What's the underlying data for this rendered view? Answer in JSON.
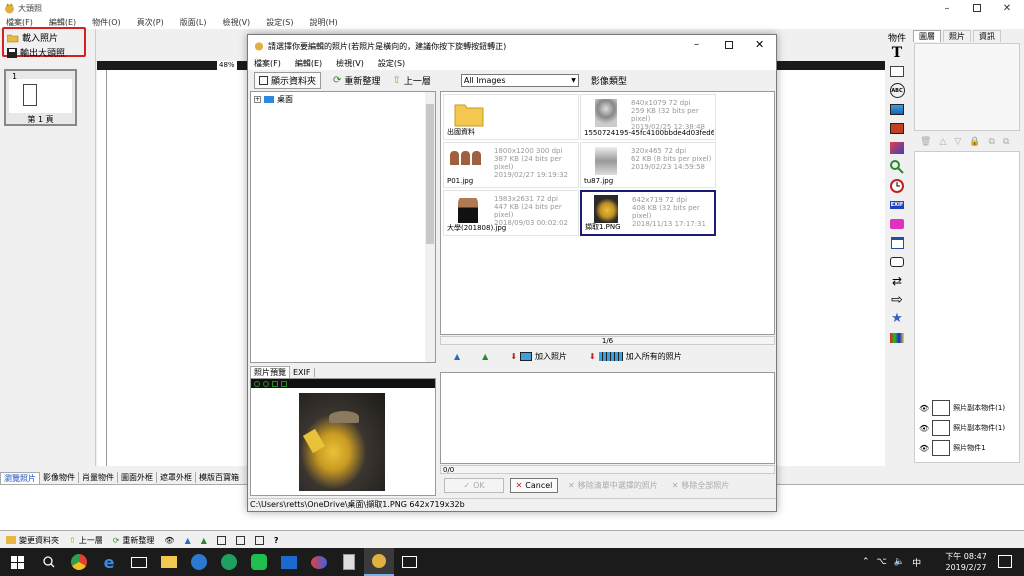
{
  "app": {
    "title": "大頭照",
    "menu": [
      "檔案(F)",
      "編輯(E)",
      "物件(O)",
      "頁次(P)",
      "版面(L)",
      "檢視(V)",
      "設定(S)",
      "說明(H)"
    ],
    "zoom": "48%"
  },
  "left_panel": {
    "load_photo": "載入照片",
    "export_photo": "輸出大頭照",
    "page_index": "1",
    "page_label": "第 1 頁"
  },
  "right_tools": {
    "header": "物件",
    "tabs": [
      "圖層",
      "照片",
      "資訊"
    ],
    "layers": [
      "照片副本物件(1)",
      "照片副本物件(1)",
      "照片物件1"
    ]
  },
  "bottom_tabs": [
    "瀏覽照片",
    "影像物件",
    "肖量物件",
    "圖面外框",
    "遮罩外框",
    "模版百寶箱"
  ],
  "bottom_toolbar": {
    "change_folder": "變更資料夾",
    "up": "上一層",
    "refresh": "重新整理"
  },
  "dialog": {
    "title": "請選擇你要編輯的照片(若照片是橫向的，建議你按下旋轉按鈕轉正)",
    "menu": [
      "檔案(F)",
      "編輯(E)",
      "檢視(V)",
      "設定(S)"
    ],
    "show_folder": "顯示資料夾",
    "refresh": "重新整理",
    "up": "上一層",
    "filter": "All Images",
    "image_type": "影像類型",
    "tree_root": "桌面",
    "files": [
      {
        "name": "出國資料",
        "meta": []
      },
      {
        "name": "1550724195-45fc4100bbde4d03fed6...",
        "meta": [
          "840x1079 72 dpi",
          "259 KB (32 bits per pixel)",
          "2019/02/25 12:38:48"
        ]
      },
      {
        "name": "P01.jpg",
        "meta": [
          "1800x1200 300 dpi",
          "387 KB (24 bits per pixel)",
          "2019/02/27 19:19:32"
        ]
      },
      {
        "name": "tu87.jpg",
        "meta": [
          "320x465 72 dpi",
          "62 KB (8 bits per pixel)",
          "2019/02/23 14:59:58"
        ]
      },
      {
        "name": "大學(201808).jpg",
        "meta": [
          "1983x2631 72 dpi",
          "447 KB (24 bits per pixel)",
          "2018/09/03 00:02:02"
        ]
      },
      {
        "name": "擷取1.PNG",
        "meta": [
          "642x719 72 dpi",
          "408 KB (32 bits per pixel)",
          "2018/11/13 17:17:31"
        ]
      }
    ],
    "page_counter": "1/6",
    "add_photo": "加入照片",
    "add_all_photos": "加入所有的照片",
    "preview_tab": "照片預覽",
    "exif_tab": "EXIF",
    "list_counter": "0/0",
    "ok": "OK",
    "cancel": "Cancel",
    "remove_selected": "移除清單中選擇的照片",
    "remove_all": "移除全部照片",
    "status": "C:\\Users\\retts\\OneDrive\\桌面\\擷取1.PNG  642x719x32b"
  },
  "taskbar": {
    "time": "下午 08:47",
    "date": "2019/2/27",
    "ime": "中"
  },
  "colors": {
    "selected_border": "#1b1b7a",
    "highlight_red": "#d42020",
    "taskbar": "#1b1b1b"
  }
}
